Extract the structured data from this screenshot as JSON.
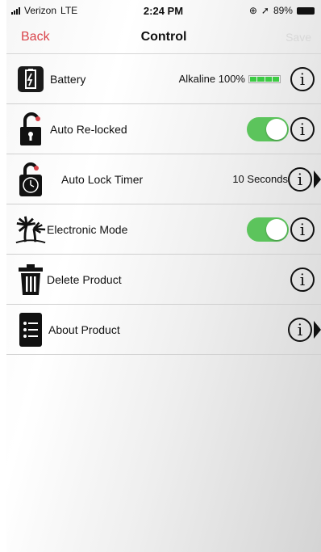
{
  "status_bar": {
    "carrier": "Verizon",
    "network": "LTE",
    "time": "2:24 PM",
    "battery": "89%"
  },
  "nav": {
    "back": "Back",
    "title": "Control",
    "save": "Save"
  },
  "rows": [
    {
      "label": "Battery",
      "value": "Alkaline 100%",
      "battery_level": 1.0
    },
    {
      "label": "Auto Re-locked",
      "toggle_on": true
    },
    {
      "label": "Auto Lock Timer",
      "value": "10 Seconds"
    },
    {
      "label": "Electronic Mode",
      "toggle_on": true
    },
    {
      "label": "Delete Product"
    },
    {
      "label": "About Product"
    }
  ],
  "info_glyph": "i",
  "colors": {
    "accent": "#d9434a",
    "toggle_on": "#5cc45c",
    "battery_fill": "#3ccb44"
  }
}
